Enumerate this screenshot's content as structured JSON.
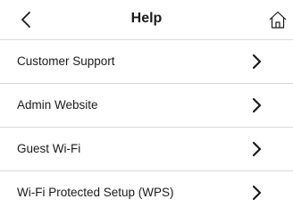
{
  "header": {
    "title": "Help",
    "back_icon": "chevron-left-icon",
    "home_icon": "home-icon"
  },
  "menu": {
    "items": [
      {
        "label": "Customer Support",
        "icon": "chevron-right-icon"
      },
      {
        "label": "Admin Website",
        "icon": "chevron-right-icon"
      },
      {
        "label": "Guest Wi-Fi",
        "icon": "chevron-right-icon"
      },
      {
        "label": "Wi-Fi Protected Setup (WPS)",
        "icon": "chevron-right-icon"
      }
    ]
  },
  "colors": {
    "text": "#1a1a1a",
    "divider": "#d9d9d9",
    "background": "#ffffff"
  }
}
